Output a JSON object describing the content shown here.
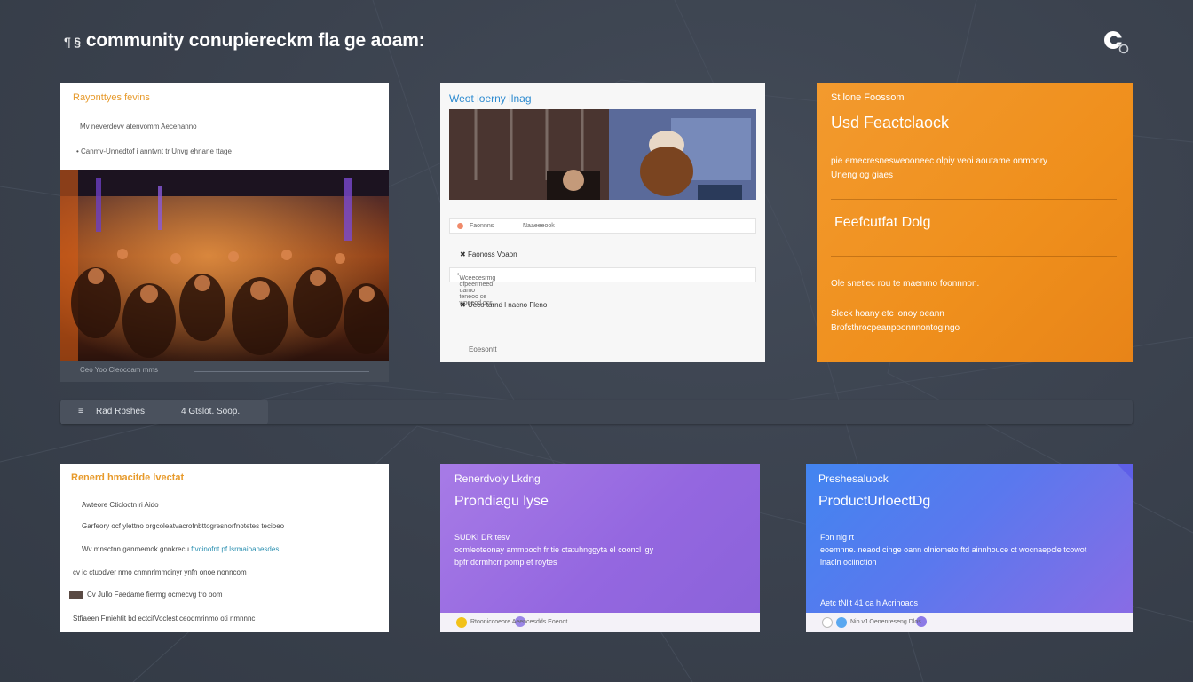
{
  "header": {
    "title": "community conupiereckm fla ge aoam:",
    "lead_glyphs": "¶ §"
  },
  "card1": {
    "kicker": "Rayonttyes fevins",
    "line1": "Mv neverdevv atenvomm Aecenanno",
    "line2": "Canmv-Unnedtof i anntvnt tr Unvg ehnane ttage",
    "caption": "Ceo Yoo Cleocoam mms"
  },
  "toolbar": {
    "left_label": "Rad Rpshes",
    "right_label": "4 Gtslot. Soop."
  },
  "card2": {
    "kicker": "Weot loerny ilnag",
    "row1": [
      "Faonnns",
      "Naaeeeook"
    ],
    "label1": "Faonoss Voaon",
    "row2": "Wceecesrmg ofpeerrneed uamo teneoo  ce wodeod ocs",
    "label2": "Ueco tarnd l nacno Fleno",
    "footer": "Eoesontt"
  },
  "card3": {
    "kicker": "St lone Foossom",
    "title": "Usd Feactclaock",
    "desc1": "pie emecresnesweooneec olpiy veoi aoutame onmoory",
    "desc2": "Uneng og giaes",
    "subtitle": "Feefcutfat Dolg",
    "desc3": "Ole snetlec rou te maenmo foonnnon.",
    "desc4": "Sleck hoany etc lonoy oeann",
    "desc5": "Brofsthrocpeanpoonnnontogingo"
  },
  "card4": {
    "kicker": "Renerd hmacitde lvectat",
    "lines": [
      "Awteore Cticloctn ri Aido",
      "Garfeory ocf ylettno orgcoleatvacrofnbttogresnorfnotetes tecioeo",
      "Wv mnsctnn ganmemok gnnkrecu",
      "cv ic ctuodver nmo cnmnrlmmcinyr ynfn onoe nonncom",
      "Cv Jullo Faedame fiermg ocmecvg tro oom",
      "Stfiaeen Fmiehtit bd ectcitVoclest ceodmrinmo oti nmnnnc"
    ],
    "link_fragment": "ftvcinofnt pf lsrmaioanesdes"
  },
  "card5": {
    "kicker": "Renerdvoly Lkdng",
    "title": "Prondiagu lyse",
    "meta": "SUDKI DR tesv",
    "desc1": "ocmleoteonay ammpoch fr tie ctatuhnggyta el cooncl lgy",
    "desc2": "bpfr dcrmhcrr pomp et roytes",
    "footer": "Rtooniccoeore   Aeencesdds  Eoeoot"
  },
  "card6": {
    "kicker": "Preshesaluock",
    "title": "ProductUrloectDg",
    "meta": "Fon nig rt",
    "desc1": "eoemnne. neaod cinge oann olniometo ftd ainnhouce ct wocnaepcle tcowot",
    "desc2": "lnacln ociinction",
    "tag": "Aetc tNlit 41 ca h Acrinoaos",
    "footer": "Nio vJ  Oenenreseng  Dlos"
  },
  "colors": {
    "background": "#3b4350",
    "orange": "#f0921f",
    "purple": "#9b6fe2",
    "blue": "#4a82ef",
    "accent_orange_text": "#e79a2b"
  }
}
